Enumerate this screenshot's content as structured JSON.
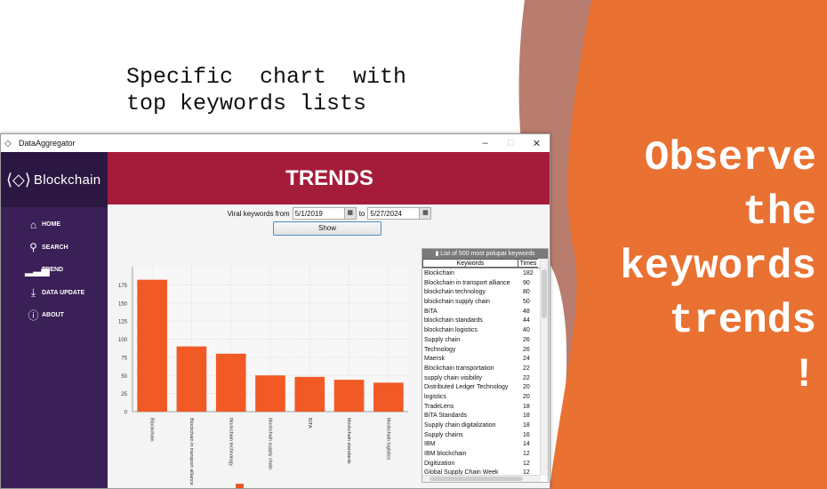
{
  "caption": "Specific  chart  with\ntop keywords lists",
  "headline": [
    "Observe",
    "the",
    "keywords",
    "trends",
    "!"
  ],
  "colors": {
    "orange": "#e97132",
    "muted_stripe": "#b87d6e",
    "banner": "#a51c3a",
    "sidebar": "#3b1f57",
    "bar": "#f15a24"
  },
  "window": {
    "title": "DataAggregator",
    "minimize": "–",
    "maximize": "□",
    "close": "✕"
  },
  "sidebar": {
    "brand": "Blockchain",
    "items": [
      {
        "icon": "home-icon",
        "glyph": "🏠",
        "label": "HOME"
      },
      {
        "icon": "search-icon",
        "glyph": "🔍",
        "label": "SEARCH"
      },
      {
        "icon": "signal-bars-icon",
        "glyph": "📶",
        "label": "TREND"
      },
      {
        "icon": "download-icon",
        "glyph": "⤓",
        "label": "DATA UPDATE"
      },
      {
        "icon": "info-icon",
        "glyph": "ℹ",
        "label": "ABOUT"
      }
    ]
  },
  "banner": "TRENDS",
  "filter": {
    "label": "Viral keywords from",
    "from": "5/1/2019",
    "to_label": "to",
    "to": "5/27/2024",
    "show_button": "Show"
  },
  "list": {
    "header": "List of 500 most polupar keywords",
    "col_keywords": "Keywords",
    "col_times": "Times",
    "rows": [
      [
        "Blockchain",
        "182"
      ],
      [
        "Blockchain in transport alliance",
        "90"
      ],
      [
        "blockchain technology",
        "80"
      ],
      [
        "blockchain supply chain",
        "50"
      ],
      [
        "BiTA",
        "48"
      ],
      [
        "blockchain standards",
        "44"
      ],
      [
        "blockchain logistics",
        "40"
      ],
      [
        "Supply chain",
        "26"
      ],
      [
        "Technology",
        "26"
      ],
      [
        "Maersk",
        "24"
      ],
      [
        "Blockchain transportation",
        "22"
      ],
      [
        "supply chain visibility",
        "22"
      ],
      [
        "Distributed Ledger Technology",
        "20"
      ],
      [
        "logistics",
        "20"
      ],
      [
        "TradeLens",
        "18"
      ],
      [
        "BiTA Standards",
        "18"
      ],
      [
        "Supply chain digitalization",
        "18"
      ],
      [
        "Supply chains",
        "16"
      ],
      [
        "IBM",
        "14"
      ],
      [
        "IBM blockchain",
        "12"
      ],
      [
        "Digitization",
        "12"
      ],
      [
        "Global Supply Chain Week",
        "12"
      ]
    ]
  },
  "chart_data": {
    "type": "bar",
    "categories": [
      "Blockchain",
      "Blockchain in transport alliance",
      "blockchain technology",
      "blockchain supply chain",
      "BiTA",
      "blockchain standards",
      "blockchain logistics"
    ],
    "values": [
      182,
      90,
      80,
      50,
      48,
      44,
      40
    ],
    "ylim": [
      0,
      200
    ],
    "yticks": [
      0,
      25,
      50,
      75,
      100,
      125,
      150,
      175
    ],
    "grid": true,
    "legend": "bottom",
    "bar_color": "#f15a24"
  }
}
